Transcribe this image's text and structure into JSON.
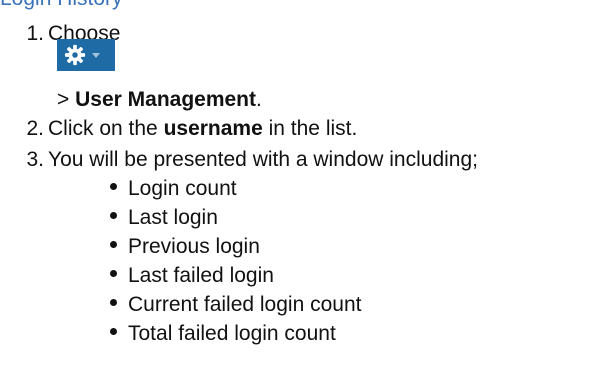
{
  "header": {
    "link_text": "Login History"
  },
  "steps": [
    {
      "number": "1.",
      "text": "Choose"
    },
    {
      "number": "2.",
      "pre": "Click on the ",
      "bold": "username",
      "post": " in the list."
    },
    {
      "number": "3.",
      "text": "You will be presented with a window including;"
    }
  ],
  "step1_cont": {
    "prefix": "> ",
    "bold": "User Management",
    "suffix": "."
  },
  "settings_button": {
    "icon": "gear-icon",
    "dropdown_icon": "chevron-down-icon",
    "bg_color": "#1f6ba5"
  },
  "bullets": [
    "Login count",
    "Last login",
    "Previous login",
    "Last failed login",
    "Current failed login count",
    "Total failed login count"
  ]
}
